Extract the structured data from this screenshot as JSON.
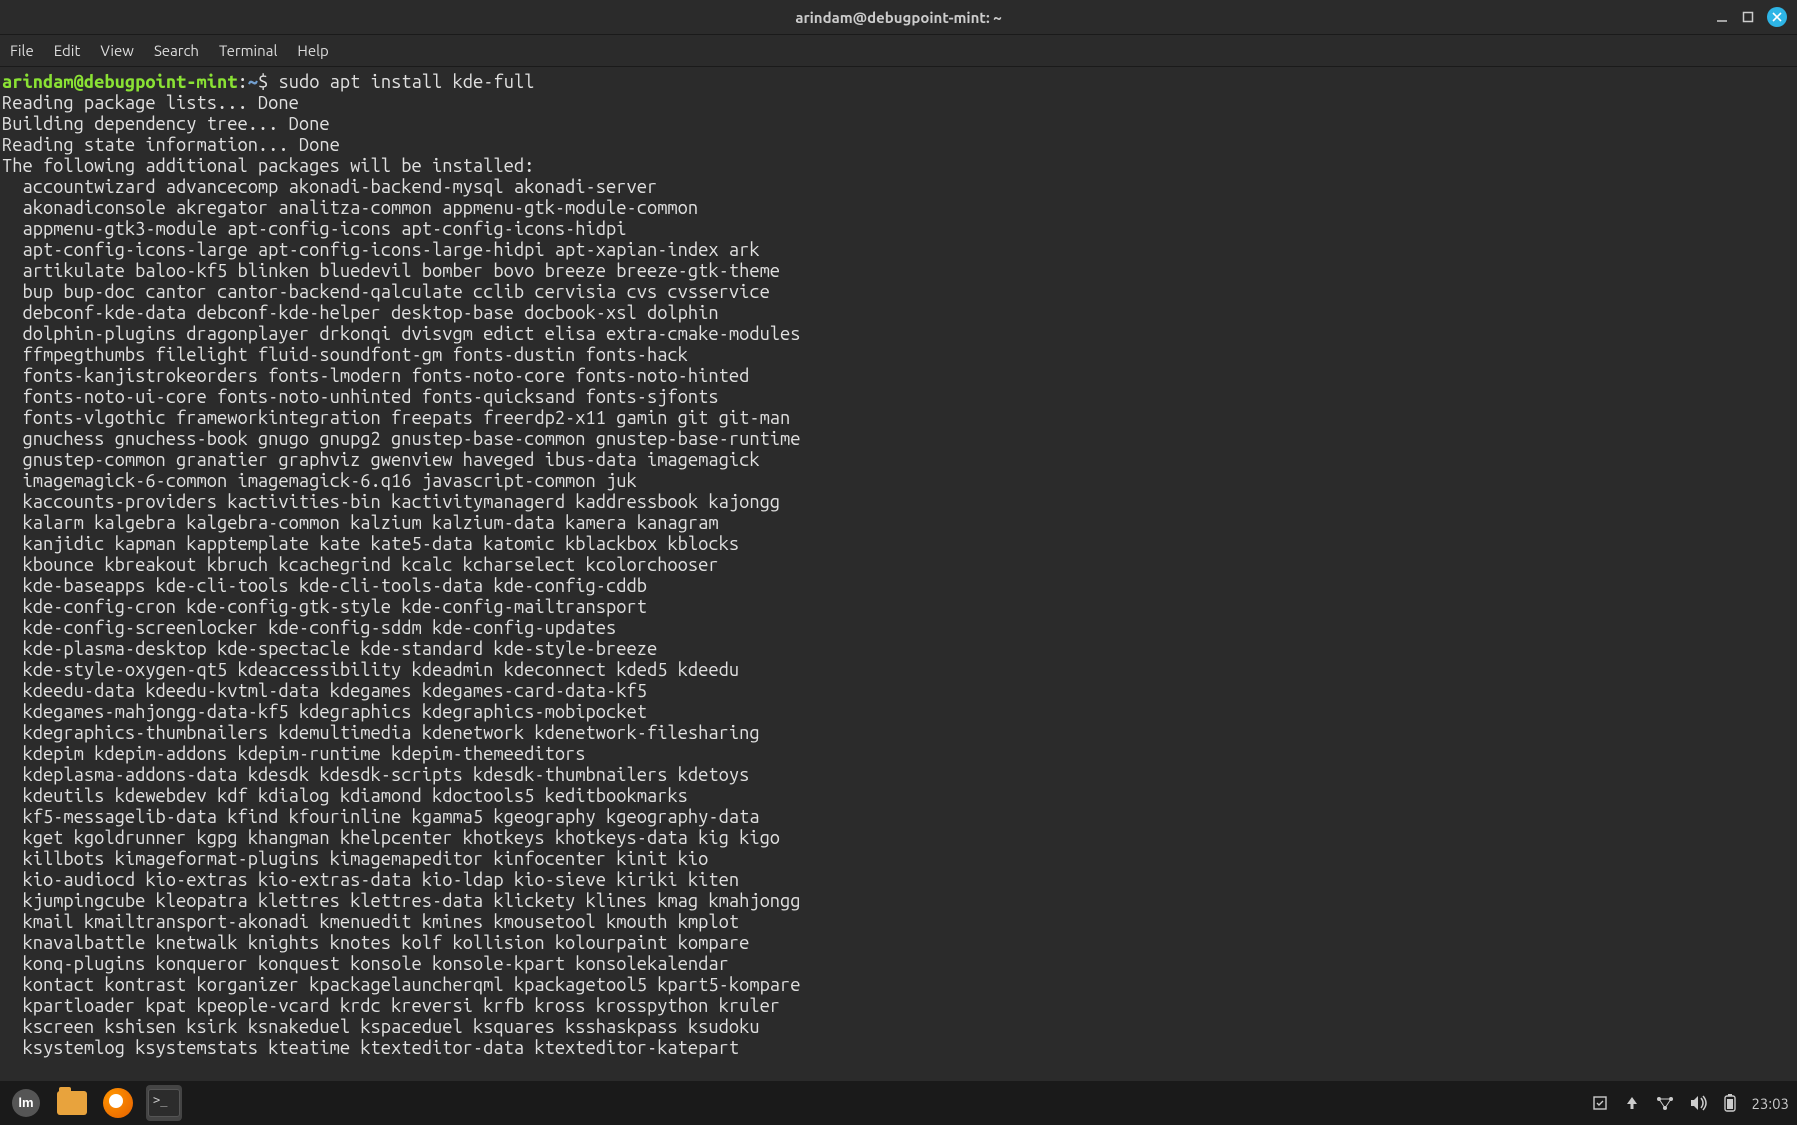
{
  "window": {
    "title": "arindam@debugpoint-mint: ~"
  },
  "menubar": {
    "items": [
      "File",
      "Edit",
      "View",
      "Search",
      "Terminal",
      "Help"
    ]
  },
  "prompt": {
    "user": "arindam",
    "host": "debugpoint-mint",
    "path": "~",
    "symbol": "$"
  },
  "command": "sudo apt install kde-full",
  "output_header": [
    "Reading package lists... Done",
    "Building dependency tree... Done",
    "Reading state information... Done",
    "The following additional packages will be installed:"
  ],
  "packages": [
    "accountwizard advancecomp akonadi-backend-mysql akonadi-server",
    "akonadiconsole akregator analitza-common appmenu-gtk-module-common",
    "appmenu-gtk3-module apt-config-icons apt-config-icons-hidpi",
    "apt-config-icons-large apt-config-icons-large-hidpi apt-xapian-index ark",
    "artikulate baloo-kf5 blinken bluedevil bomber bovo breeze breeze-gtk-theme",
    "bup bup-doc cantor cantor-backend-qalculate cclib cervisia cvs cvsservice",
    "debconf-kde-data debconf-kde-helper desktop-base docbook-xsl dolphin",
    "dolphin-plugins dragonplayer drkonqi dvisvgm edict elisa extra-cmake-modules",
    "ffmpegthumbs filelight fluid-soundfont-gm fonts-dustin fonts-hack",
    "fonts-kanjistrokeorders fonts-lmodern fonts-noto-core fonts-noto-hinted",
    "fonts-noto-ui-core fonts-noto-unhinted fonts-quicksand fonts-sjfonts",
    "fonts-vlgothic frameworkintegration freepats freerdp2-x11 gamin git git-man",
    "gnuchess gnuchess-book gnugo gnupg2 gnustep-base-common gnustep-base-runtime",
    "gnustep-common granatier graphviz gwenview haveged ibus-data imagemagick",
    "imagemagick-6-common imagemagick-6.q16 javascript-common juk",
    "kaccounts-providers kactivities-bin kactivitymanagerd kaddressbook kajongg",
    "kalarm kalgebra kalgebra-common kalzium kalzium-data kamera kanagram",
    "kanjidic kapman kapptemplate kate kate5-data katomic kblackbox kblocks",
    "kbounce kbreakout kbruch kcachegrind kcalc kcharselect kcolorchooser",
    "kde-baseapps kde-cli-tools kde-cli-tools-data kde-config-cddb",
    "kde-config-cron kde-config-gtk-style kde-config-mailtransport",
    "kde-config-screenlocker kde-config-sddm kde-config-updates",
    "kde-plasma-desktop kde-spectacle kde-standard kde-style-breeze",
    "kde-style-oxygen-qt5 kdeaccessibility kdeadmin kdeconnect kded5 kdeedu",
    "kdeedu-data kdeedu-kvtml-data kdegames kdegames-card-data-kf5",
    "kdegames-mahjongg-data-kf5 kdegraphics kdegraphics-mobipocket",
    "kdegraphics-thumbnailers kdemultimedia kdenetwork kdenetwork-filesharing",
    "kdepim kdepim-addons kdepim-runtime kdepim-themeeditors",
    "kdeplasma-addons-data kdesdk kdesdk-scripts kdesdk-thumbnailers kdetoys",
    "kdeutils kdewebdev kdf kdialog kdiamond kdoctools5 keditbookmarks",
    "kf5-messagelib-data kfind kfourinline kgamma5 kgeography kgeography-data",
    "kget kgoldrunner kgpg khangman khelpcenter khotkeys khotkeys-data kig kigo",
    "killbots kimageformat-plugins kimagemapeditor kinfocenter kinit kio",
    "kio-audiocd kio-extras kio-extras-data kio-ldap kio-sieve kiriki kiten",
    "kjumpingcube kleopatra klettres klettres-data klickety klines kmag kmahjongg",
    "kmail kmailtransport-akonadi kmenuedit kmines kmousetool kmouth kmplot",
    "knavalbattle knetwalk knights knotes kolf kollision kolourpaint kompare",
    "konq-plugins konqueror konquest konsole konsole-kpart konsolekalendar",
    "kontact kontrast korganizer kpackagelauncherqml kpackagetool5 kpart5-kompare",
    "kpartloader kpat kpeople-vcard krdc kreversi krfb kross krosspython kruler",
    "kscreen kshisen ksirk ksnakeduel kspaceduel ksquares ksshaskpass ksudoku",
    "ksystemlog ksystemstats kteatime ktexteditor-data ktexteditor-katepart"
  ],
  "taskbar": {
    "clock": "23:03"
  }
}
